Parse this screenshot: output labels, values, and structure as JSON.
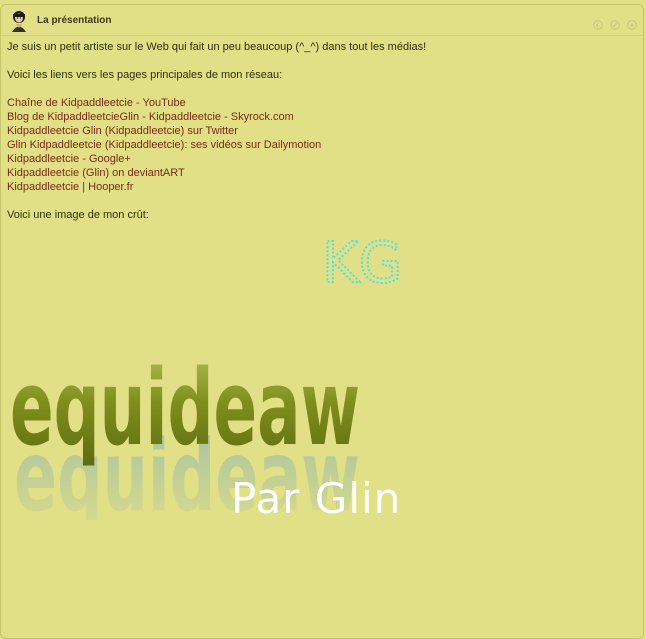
{
  "header": {
    "title": "La présentation"
  },
  "post": {
    "intro": "Je suis un petit artiste sur le Web qui fait un peu beaucoup (^_^) dans tout les médias!",
    "links_intro": "Voici les liens vers les pages principales de mon réseau:",
    "links": [
      "Chaîne de Kidpaddleetcie - YouTube",
      "Blog de KidpaddleetcieGlin - Kidpaddleetcie - Skyrock.com",
      "Kidpaddleetcie Glin (Kidpaddleetcie) sur Twitter",
      "Glin Kidpaddleetcie (Kidpaddleetcie): ses vidéos sur Dailymotion",
      "Kidpaddleetcie - Google+",
      "Kidpaddleetcie (Glin) on deviantART",
      "Kidpaddleetcie | Hooper.fr"
    ],
    "image_intro": "Voici une image de mon crût:"
  },
  "artwork": {
    "kg_text": "KG",
    "logo_text": "equideaw",
    "signature": "Par Glin"
  },
  "colors": {
    "background": "#e2e086",
    "link": "#7a2a12",
    "logo_green": "#7f8f1c",
    "kg_cyan": "#4fe0e6"
  },
  "icons": [
    "avatar-icon",
    "reply-icon",
    "edit-icon",
    "delete-icon"
  ]
}
